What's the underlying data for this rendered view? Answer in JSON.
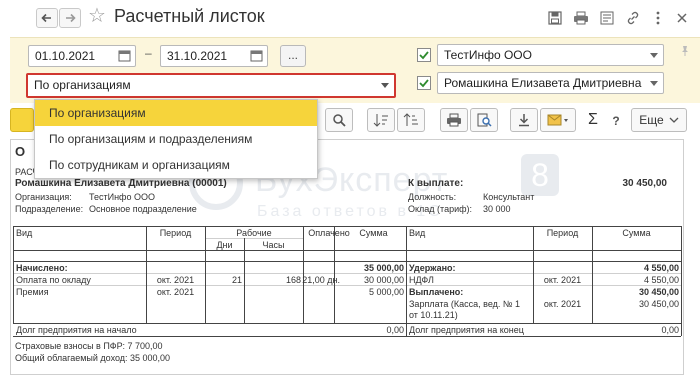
{
  "window": {
    "title": "Расчетный листок"
  },
  "filters": {
    "date_from": "01.10.2021",
    "date_to": "31.10.2021",
    "dash": "–",
    "dots_label": "...",
    "organization": "ТестИнфо ООО",
    "employee": "Ромашкина Елизавета Дмитриевна",
    "grouping_value": "По организациям"
  },
  "grouping_options": [
    "По организациям",
    "По организациям и подразделениям",
    "По сотрудникам и организациям"
  ],
  "toolbar": {
    "more_label": "Еще"
  },
  "watermark": {
    "brand": "БухЭксперт",
    "tagline": "База ответов",
    "suffix": "в 1С",
    "digit": "8"
  },
  "report": {
    "letter_o": "О",
    "header_partial": "РАСЧЕТНЫЙ ЛИСТОК",
    "employee_line": "Ромашкина Елизавета Дмитриевна (00001)",
    "org_label": "Организация:",
    "org_value": "ТестИнфо ООО",
    "dept_label": "Подразделение:",
    "dept_value": "Основное подразделение",
    "to_pay_label": "К выплате:",
    "to_pay_value": "30 450,00",
    "position_label": "Должность:",
    "position_value": "Консультант",
    "salary_label": "Оклад (тариф):",
    "salary_value": "30 000",
    "cols_left": {
      "vid": "Вид",
      "period": "Период",
      "work": "Рабочие",
      "days": "Дни",
      "hours": "Часы",
      "paid": "Оплачено",
      "sum": "Сумма"
    },
    "cols_right": {
      "vid": "Вид",
      "period": "Период",
      "sum": "Сумма"
    },
    "accrued_label": "Начислено:",
    "accrued_total": "35 000,00",
    "accruals": [
      {
        "name": "Оплата по окладу",
        "period": "окт. 2021",
        "days": "21",
        "hours": "168",
        "paid": "21,00 дн.",
        "sum": "30 000,00"
      },
      {
        "name": "Премия",
        "period": "окт. 2021",
        "days": "",
        "hours": "",
        "paid": "",
        "sum": "5 000,00"
      }
    ],
    "withheld_label": "Удержано:",
    "withheld_total": "4 550,00",
    "withholdings": [
      {
        "name": "НДФЛ",
        "period": "окт. 2021",
        "sum": "4 550,00"
      }
    ],
    "paid_label": "Выплачено:",
    "paid_total": "30 450,00",
    "payments": [
      {
        "name_line1": "Зарплата (Касса, вед. № 1",
        "name_line2": "от 10.11.21)",
        "period": "окт. 2021",
        "sum": "30 450,00"
      }
    ],
    "debt_start_label": "Долг предприятия на начало",
    "debt_start_value": "0,00",
    "debt_end_label": "Долг предприятия на конец",
    "debt_end_value": "0,00",
    "pension_line": "Страховые взносы в ПФР: 7 700,00",
    "taxable_line": "Общий облагаемый доход: 35 000,00"
  }
}
